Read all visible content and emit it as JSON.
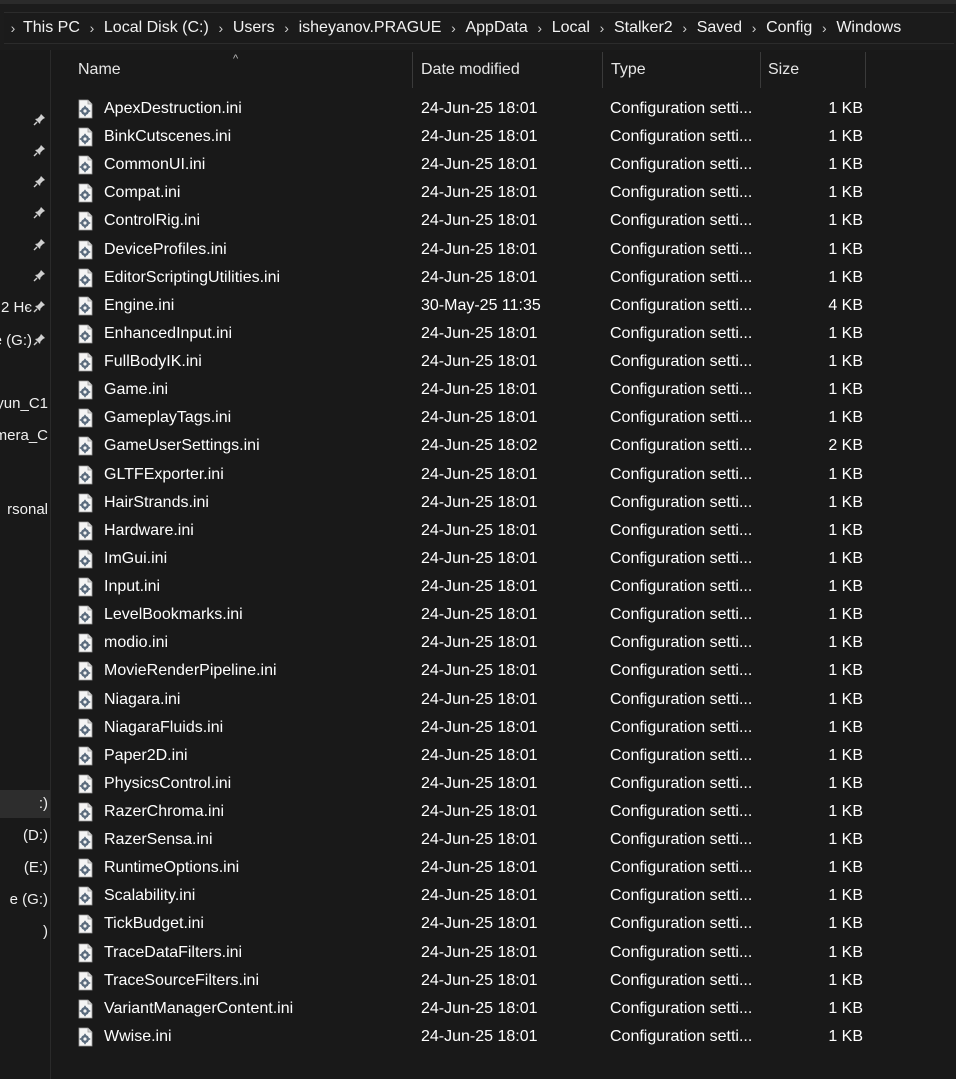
{
  "breadcrumb": [
    "This PC",
    "Local Disk (C:)",
    "Users",
    "isheyanov.PRAGUE",
    "AppData",
    "Local",
    "Stalker2",
    "Saved",
    "Config",
    "Windows"
  ],
  "sidebar": {
    "items": [
      {
        "label": "",
        "pinned": true
      },
      {
        "label": "",
        "pinned": true
      },
      {
        "label": "",
        "pinned": true
      },
      {
        "label": "",
        "pinned": true
      },
      {
        "label": "",
        "pinned": true
      },
      {
        "label": "",
        "pinned": true
      },
      {
        "label": "2 Hє",
        "pinned": true
      },
      {
        "label": "e (G:)",
        "pinned": true
      },
      {
        "label": "yun_C1",
        "pinned": false
      },
      {
        "label": "mera_C",
        "pinned": false
      },
      {
        "label": "rsonal",
        "pinned": false
      },
      {
        "label": ":)",
        "pinned": false,
        "selected": true
      },
      {
        "label": "(D:)",
        "pinned": false
      },
      {
        "label": "(E:)",
        "pinned": false
      },
      {
        "label": "e (G:)",
        "pinned": false
      },
      {
        "label": ")",
        "pinned": false
      }
    ]
  },
  "columns": {
    "name": "Name",
    "date": "Date modified",
    "type": "Type",
    "size": "Size"
  },
  "sort_indicator": "^",
  "files": [
    {
      "name": "ApexDestruction.ini",
      "date": "24-Jun-25 18:01",
      "type": "Configuration setti...",
      "size": "1 KB"
    },
    {
      "name": "BinkCutscenes.ini",
      "date": "24-Jun-25 18:01",
      "type": "Configuration setti...",
      "size": "1 KB"
    },
    {
      "name": "CommonUI.ini",
      "date": "24-Jun-25 18:01",
      "type": "Configuration setti...",
      "size": "1 KB"
    },
    {
      "name": "Compat.ini",
      "date": "24-Jun-25 18:01",
      "type": "Configuration setti...",
      "size": "1 KB"
    },
    {
      "name": "ControlRig.ini",
      "date": "24-Jun-25 18:01",
      "type": "Configuration setti...",
      "size": "1 KB"
    },
    {
      "name": "DeviceProfiles.ini",
      "date": "24-Jun-25 18:01",
      "type": "Configuration setti...",
      "size": "1 KB"
    },
    {
      "name": "EditorScriptingUtilities.ini",
      "date": "24-Jun-25 18:01",
      "type": "Configuration setti...",
      "size": "1 KB"
    },
    {
      "name": "Engine.ini",
      "date": "30-May-25 11:35",
      "type": "Configuration setti...",
      "size": "4 KB"
    },
    {
      "name": "EnhancedInput.ini",
      "date": "24-Jun-25 18:01",
      "type": "Configuration setti...",
      "size": "1 KB"
    },
    {
      "name": "FullBodyIK.ini",
      "date": "24-Jun-25 18:01",
      "type": "Configuration setti...",
      "size": "1 KB"
    },
    {
      "name": "Game.ini",
      "date": "24-Jun-25 18:01",
      "type": "Configuration setti...",
      "size": "1 KB"
    },
    {
      "name": "GameplayTags.ini",
      "date": "24-Jun-25 18:01",
      "type": "Configuration setti...",
      "size": "1 KB"
    },
    {
      "name": "GameUserSettings.ini",
      "date": "24-Jun-25 18:02",
      "type": "Configuration setti...",
      "size": "2 KB"
    },
    {
      "name": "GLTFExporter.ini",
      "date": "24-Jun-25 18:01",
      "type": "Configuration setti...",
      "size": "1 KB"
    },
    {
      "name": "HairStrands.ini",
      "date": "24-Jun-25 18:01",
      "type": "Configuration setti...",
      "size": "1 KB"
    },
    {
      "name": "Hardware.ini",
      "date": "24-Jun-25 18:01",
      "type": "Configuration setti...",
      "size": "1 KB"
    },
    {
      "name": "ImGui.ini",
      "date": "24-Jun-25 18:01",
      "type": "Configuration setti...",
      "size": "1 KB"
    },
    {
      "name": "Input.ini",
      "date": "24-Jun-25 18:01",
      "type": "Configuration setti...",
      "size": "1 KB"
    },
    {
      "name": "LevelBookmarks.ini",
      "date": "24-Jun-25 18:01",
      "type": "Configuration setti...",
      "size": "1 KB"
    },
    {
      "name": "modio.ini",
      "date": "24-Jun-25 18:01",
      "type": "Configuration setti...",
      "size": "1 KB"
    },
    {
      "name": "MovieRenderPipeline.ini",
      "date": "24-Jun-25 18:01",
      "type": "Configuration setti...",
      "size": "1 KB"
    },
    {
      "name": "Niagara.ini",
      "date": "24-Jun-25 18:01",
      "type": "Configuration setti...",
      "size": "1 KB"
    },
    {
      "name": "NiagaraFluids.ini",
      "date": "24-Jun-25 18:01",
      "type": "Configuration setti...",
      "size": "1 KB"
    },
    {
      "name": "Paper2D.ini",
      "date": "24-Jun-25 18:01",
      "type": "Configuration setti...",
      "size": "1 KB"
    },
    {
      "name": "PhysicsControl.ini",
      "date": "24-Jun-25 18:01",
      "type": "Configuration setti...",
      "size": "1 KB"
    },
    {
      "name": "RazerChroma.ini",
      "date": "24-Jun-25 18:01",
      "type": "Configuration setti...",
      "size": "1 KB"
    },
    {
      "name": "RazerSensa.ini",
      "date": "24-Jun-25 18:01",
      "type": "Configuration setti...",
      "size": "1 KB"
    },
    {
      "name": "RuntimeOptions.ini",
      "date": "24-Jun-25 18:01",
      "type": "Configuration setti...",
      "size": "1 KB"
    },
    {
      "name": "Scalability.ini",
      "date": "24-Jun-25 18:01",
      "type": "Configuration setti...",
      "size": "1 KB"
    },
    {
      "name": "TickBudget.ini",
      "date": "24-Jun-25 18:01",
      "type": "Configuration setti...",
      "size": "1 KB"
    },
    {
      "name": "TraceDataFilters.ini",
      "date": "24-Jun-25 18:01",
      "type": "Configuration setti...",
      "size": "1 KB"
    },
    {
      "name": "TraceSourceFilters.ini",
      "date": "24-Jun-25 18:01",
      "type": "Configuration setti...",
      "size": "1 KB"
    },
    {
      "name": "VariantManagerContent.ini",
      "date": "24-Jun-25 18:01",
      "type": "Configuration setti...",
      "size": "1 KB"
    },
    {
      "name": "Wwise.ini",
      "date": "24-Jun-25 18:01",
      "type": "Configuration setti...",
      "size": "1 KB"
    }
  ],
  "icons": {
    "file": "config-file-icon",
    "pin": "pin-icon",
    "separator": "chevron-right-icon"
  },
  "colors": {
    "background": "#191919",
    "text": "#ffffff",
    "selected": "#2d2d2d"
  }
}
